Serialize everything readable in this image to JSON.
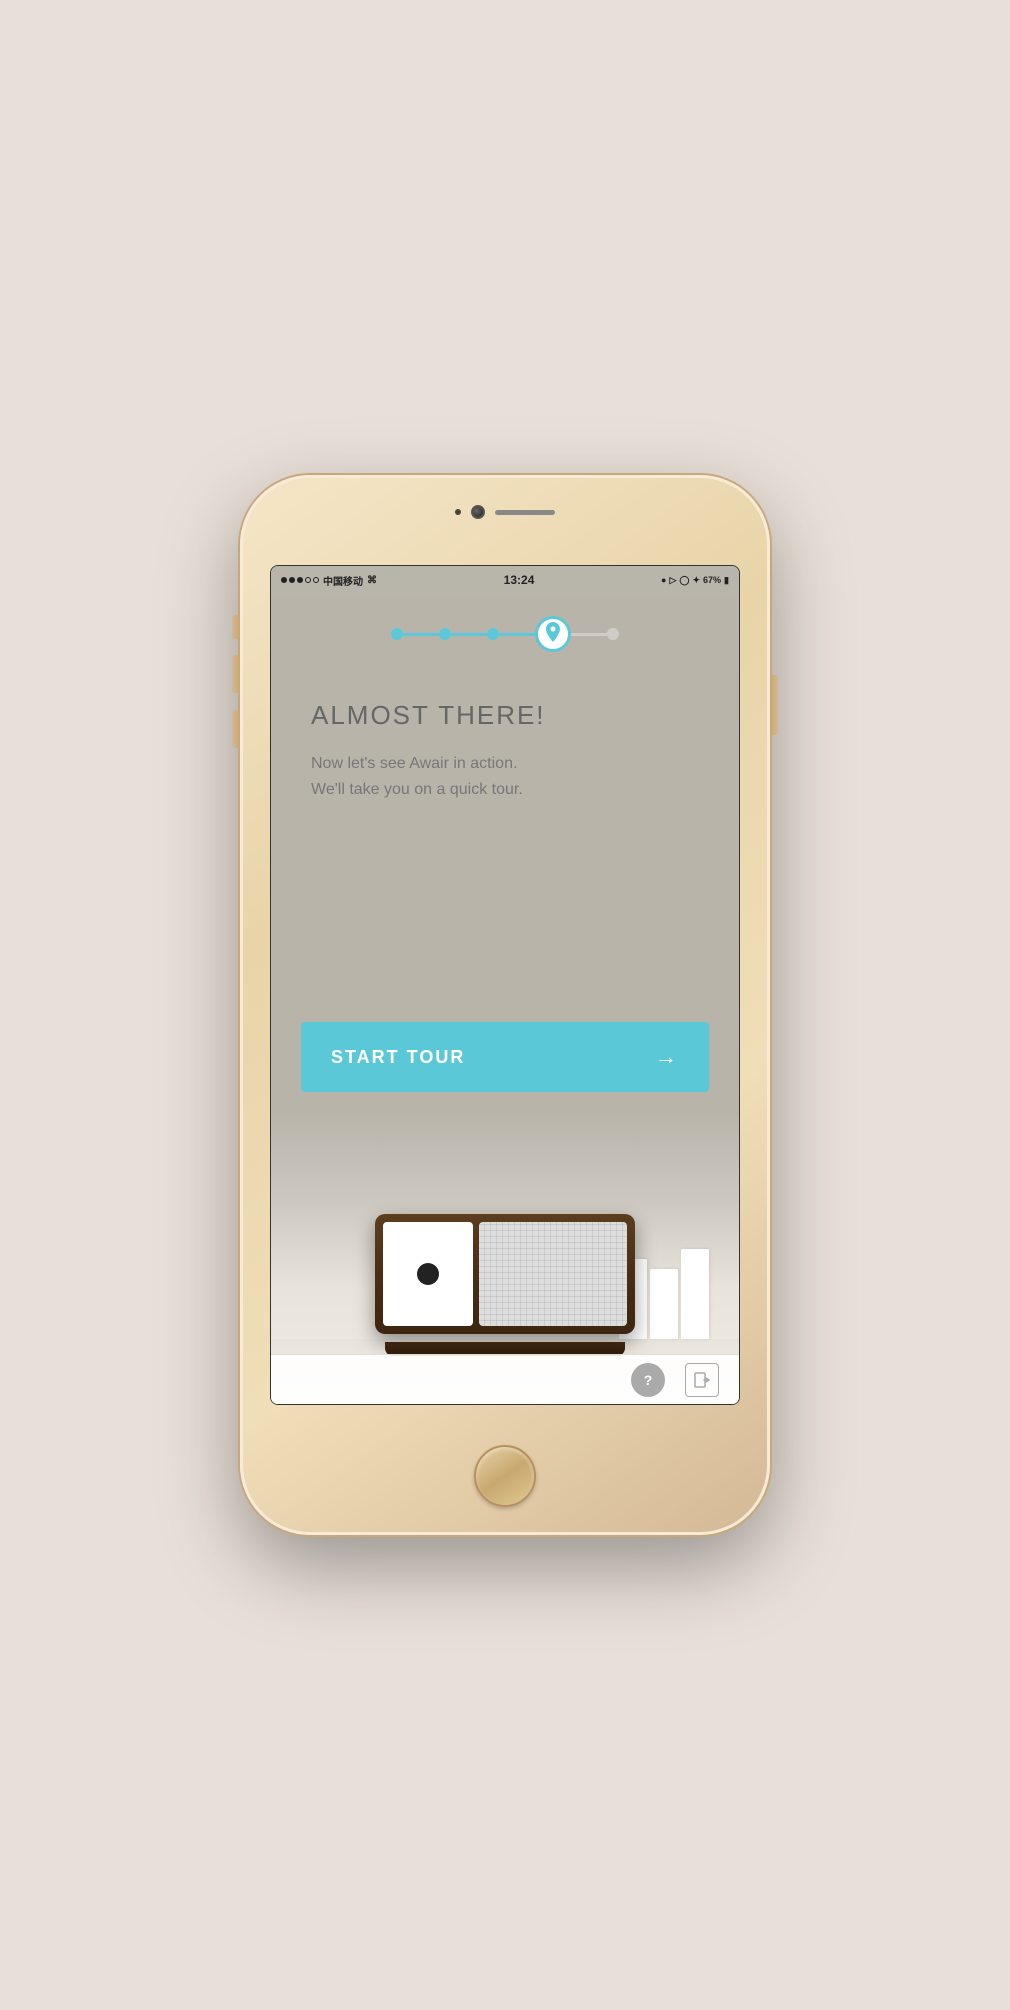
{
  "phone": {
    "status_bar": {
      "carrier": "中国移动",
      "time": "13:24",
      "battery_percent": "67%",
      "signal_full": "●●●",
      "signal_empty": "○○"
    },
    "progress": {
      "steps": [
        {
          "id": 1,
          "type": "filled"
        },
        {
          "id": 2,
          "type": "filled"
        },
        {
          "id": 3,
          "type": "filled"
        },
        {
          "id": 4,
          "type": "active"
        },
        {
          "id": 5,
          "type": "inactive"
        }
      ]
    },
    "content": {
      "headline": "ALMOST THERE!",
      "subtext_line1": "Now let's see Awair in action.",
      "subtext_line2": "We'll take you on a quick tour."
    },
    "button": {
      "label": "START TOUR",
      "arrow": "→"
    },
    "toolbar": {
      "help_label": "?",
      "exit_label": "→"
    }
  },
  "colors": {
    "accent": "#5bc8d8",
    "bg": "#b8b4aa",
    "text_dark": "#666",
    "text_mid": "#777"
  }
}
